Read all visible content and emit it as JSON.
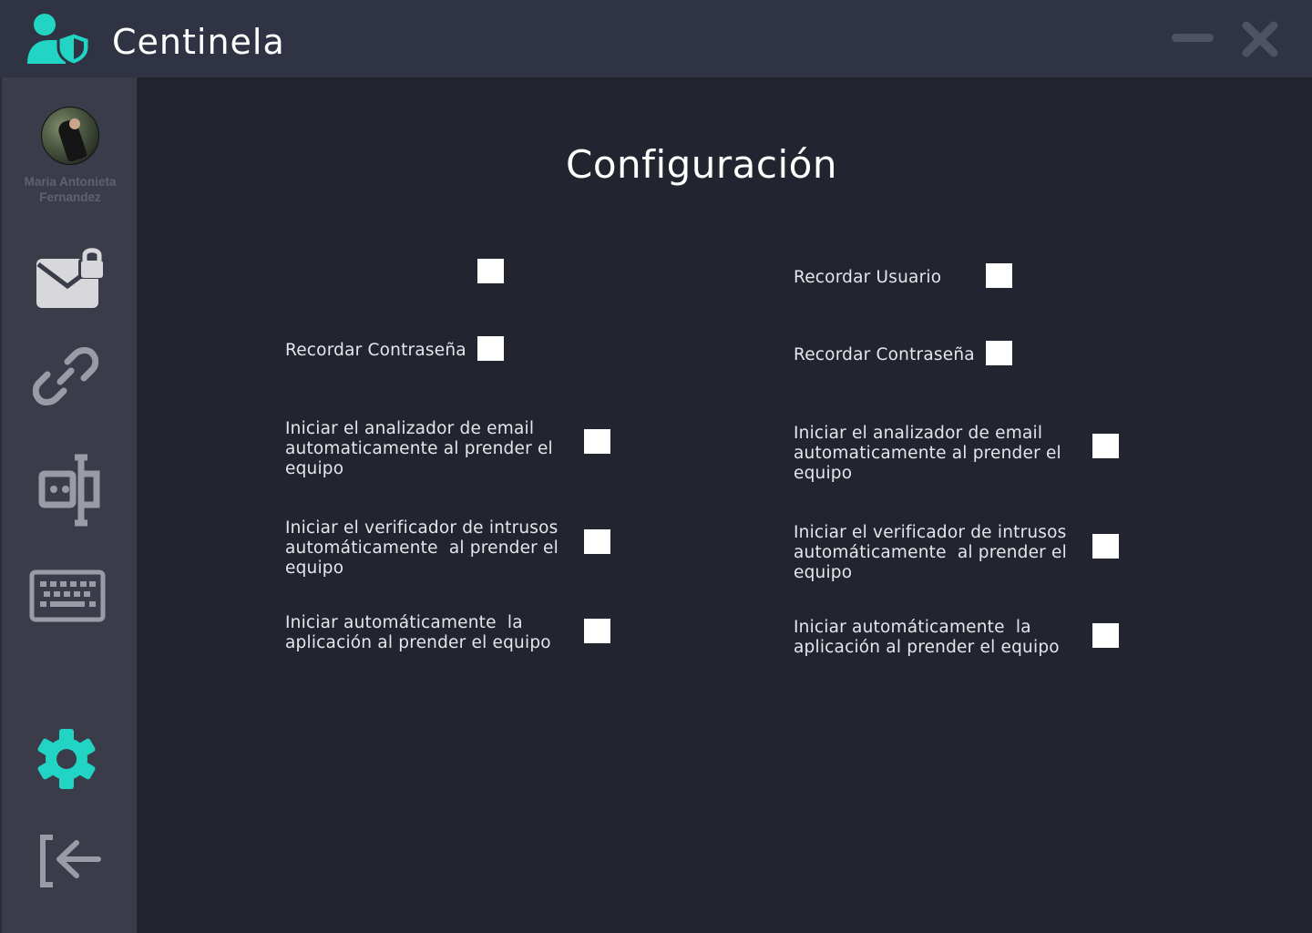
{
  "app": {
    "title": "Centinela",
    "accent_color": "#21d4c4"
  },
  "window_controls": {
    "minimize_icon": "minimize-icon",
    "close_icon": "close-icon"
  },
  "sidebar": {
    "user": {
      "name": "Maria Antonieta Fernandez"
    },
    "items": [
      {
        "icon": "mail-lock-icon"
      },
      {
        "icon": "link-icon"
      },
      {
        "icon": "text-cursor-icon"
      },
      {
        "icon": "keyboard-icon"
      },
      {
        "icon": "settings-icon",
        "active": true
      },
      {
        "icon": "logout-icon"
      }
    ]
  },
  "page": {
    "title": "Configuración"
  },
  "settings": {
    "left": [
      {
        "label": "",
        "checked": false
      },
      {
        "label": "Recordar Contraseña",
        "checked": false
      },
      {
        "label": "Iniciar el analizador de email\nautomaticamente al prender el\nequipo",
        "checked": false
      },
      {
        "label": "Iniciar el verificador de intrusos\nautomáticamente  al prender el\nequipo",
        "checked": false
      },
      {
        "label": "Iniciar automáticamente  la\naplicación al prender el equipo",
        "checked": false
      }
    ],
    "right": [
      {
        "label": "Recordar Usuario",
        "checked": false
      },
      {
        "label": "Recordar Contraseña",
        "checked": false
      },
      {
        "label": "Iniciar el analizador de email\nautomaticamente al prender el\nequipo",
        "checked": false
      },
      {
        "label": "Iniciar el verificador de intrusos\nautomáticamente  al prender el\nequipo",
        "checked": false
      },
      {
        "label": "Iniciar automáticamente  la\naplicación al prender el equipo",
        "checked": false
      }
    ]
  }
}
